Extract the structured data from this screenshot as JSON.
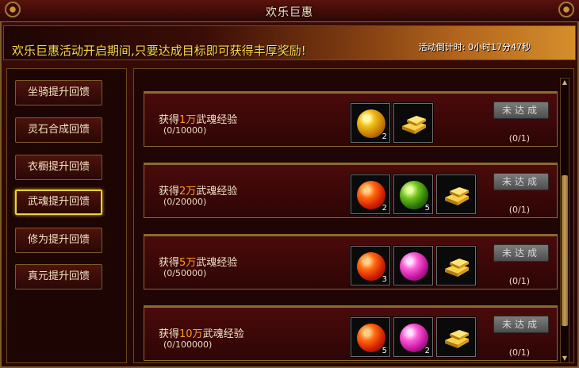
{
  "window": {
    "title": "欢乐巨惠"
  },
  "banner": {
    "headline": "欢乐巨惠活动开启期间,只要达成目标即可获得丰厚奖励!",
    "countdown": "活动倒计时: 0小时17分47秒"
  },
  "sidebar": {
    "items": [
      {
        "label": "坐骑提升回馈",
        "active": false
      },
      {
        "label": "灵石合成回馈",
        "active": false
      },
      {
        "label": "衣橱提升回馈",
        "active": false
      },
      {
        "label": "武魂提升回馈",
        "active": true
      },
      {
        "label": "修为提升回馈",
        "active": false
      },
      {
        "label": "真元提升回馈",
        "active": false
      }
    ]
  },
  "rewards": [
    {
      "prefix": "获得",
      "amount": "1万",
      "suffix": "武魂经验",
      "progress": "(0/10000)",
      "status": "(0/1)",
      "button": "未达成",
      "items": [
        {
          "icon": "yellow-orb-icon",
          "qty": "2"
        },
        {
          "icon": "gold-ingot-icon",
          "qty": ""
        }
      ]
    },
    {
      "prefix": "获得",
      "amount": "2万",
      "suffix": "武魂经验",
      "progress": "(0/20000)",
      "status": "(0/1)",
      "button": "未达成",
      "items": [
        {
          "icon": "red-orb-icon",
          "qty": "2"
        },
        {
          "icon": "green-orb-icon",
          "qty": "5"
        },
        {
          "icon": "gold-ingot-icon",
          "qty": ""
        }
      ]
    },
    {
      "prefix": "获得",
      "amount": "5万",
      "suffix": "武魂经验",
      "progress": "(0/50000)",
      "status": "(0/1)",
      "button": "未达成",
      "items": [
        {
          "icon": "red-orb-icon",
          "qty": "3"
        },
        {
          "icon": "pink-orb-icon",
          "qty": ""
        },
        {
          "icon": "gold-ingot-icon",
          "qty": ""
        }
      ]
    },
    {
      "prefix": "获得",
      "amount": "10万",
      "suffix": "武魂经验",
      "progress": "(0/100000)",
      "status": "(0/1)",
      "button": "未达成",
      "items": [
        {
          "icon": "red-orb-icon",
          "qty": "5"
        },
        {
          "icon": "pink-orb-icon",
          "qty": "2"
        },
        {
          "icon": "gold-ingot-icon",
          "qty": ""
        }
      ]
    }
  ]
}
